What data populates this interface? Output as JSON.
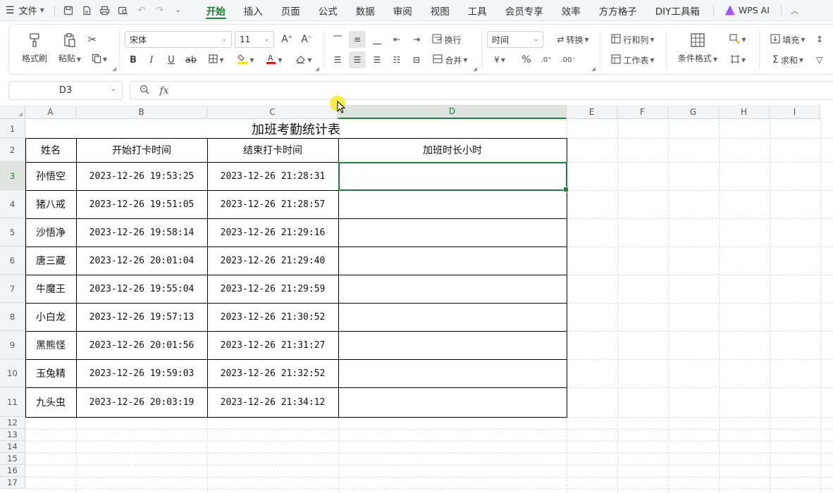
{
  "menubar": {
    "file_menu": "文件",
    "tabs": [
      {
        "label": "开始",
        "active": true
      },
      {
        "label": "插入"
      },
      {
        "label": "页面"
      },
      {
        "label": "公式"
      },
      {
        "label": "数据"
      },
      {
        "label": "审阅"
      },
      {
        "label": "视图"
      },
      {
        "label": "工具"
      },
      {
        "label": "会员专享"
      },
      {
        "label": "效率"
      },
      {
        "label": "方方格子"
      },
      {
        "label": "DIY工具箱"
      }
    ],
    "ai_label": "WPS AI"
  },
  "ribbon": {
    "format_painter": "格式刷",
    "paste": "粘贴",
    "font_name": "宋体",
    "font_size": "11",
    "wrap_text": "换行",
    "merge": "合并",
    "number_format": "时间",
    "convert": "转换",
    "rows_cols": "行和列",
    "worksheet": "工作表",
    "cond_format": "条件格式",
    "fill": "填充",
    "sum": "求和",
    "currency_symbol": "¥",
    "percent_symbol": "%"
  },
  "formula_bar": {
    "name_box": "D3",
    "fx_label": "fx",
    "formula": ""
  },
  "sheet": {
    "columns": [
      "A",
      "B",
      "C",
      "D",
      "E",
      "F",
      "G",
      "H",
      "I"
    ],
    "rows": [
      "1",
      "2",
      "3",
      "4",
      "5",
      "6",
      "7",
      "8",
      "9",
      "10",
      "11",
      "12",
      "13",
      "14",
      "15",
      "16",
      "17"
    ],
    "selected_cell": "D3",
    "title": "加班考勤统计表",
    "headers": [
      "姓名",
      "开始打卡时间",
      "结束打卡时间",
      "加班时长小时"
    ],
    "records": [
      [
        "孙悟空",
        "2023-12-26 19:53:25",
        "2023-12-26 21:28:31",
        ""
      ],
      [
        "猪八戒",
        "2023-12-26 19:51:05",
        "2023-12-26 21:28:57",
        ""
      ],
      [
        "沙悟净",
        "2023-12-26 19:58:14",
        "2023-12-26 21:29:16",
        ""
      ],
      [
        "唐三藏",
        "2023-12-26 20:01:04",
        "2023-12-26 21:29:40",
        ""
      ],
      [
        "牛魔王",
        "2023-12-26 19:55:04",
        "2023-12-26 21:29:59",
        ""
      ],
      [
        "小白龙",
        "2023-12-26 19:57:13",
        "2023-12-26 21:30:52",
        ""
      ],
      [
        "黑熊怪",
        "2023-12-26 20:01:56",
        "2023-12-26 21:31:27",
        ""
      ],
      [
        "玉兔精",
        "2023-12-26 19:59:03",
        "2023-12-26 21:32:52",
        ""
      ],
      [
        "九头虫",
        "2023-12-26 20:03:19",
        "2023-12-26 21:34:12",
        ""
      ]
    ]
  },
  "colors": {
    "accent": "#1a7f37",
    "border": "#000000"
  }
}
